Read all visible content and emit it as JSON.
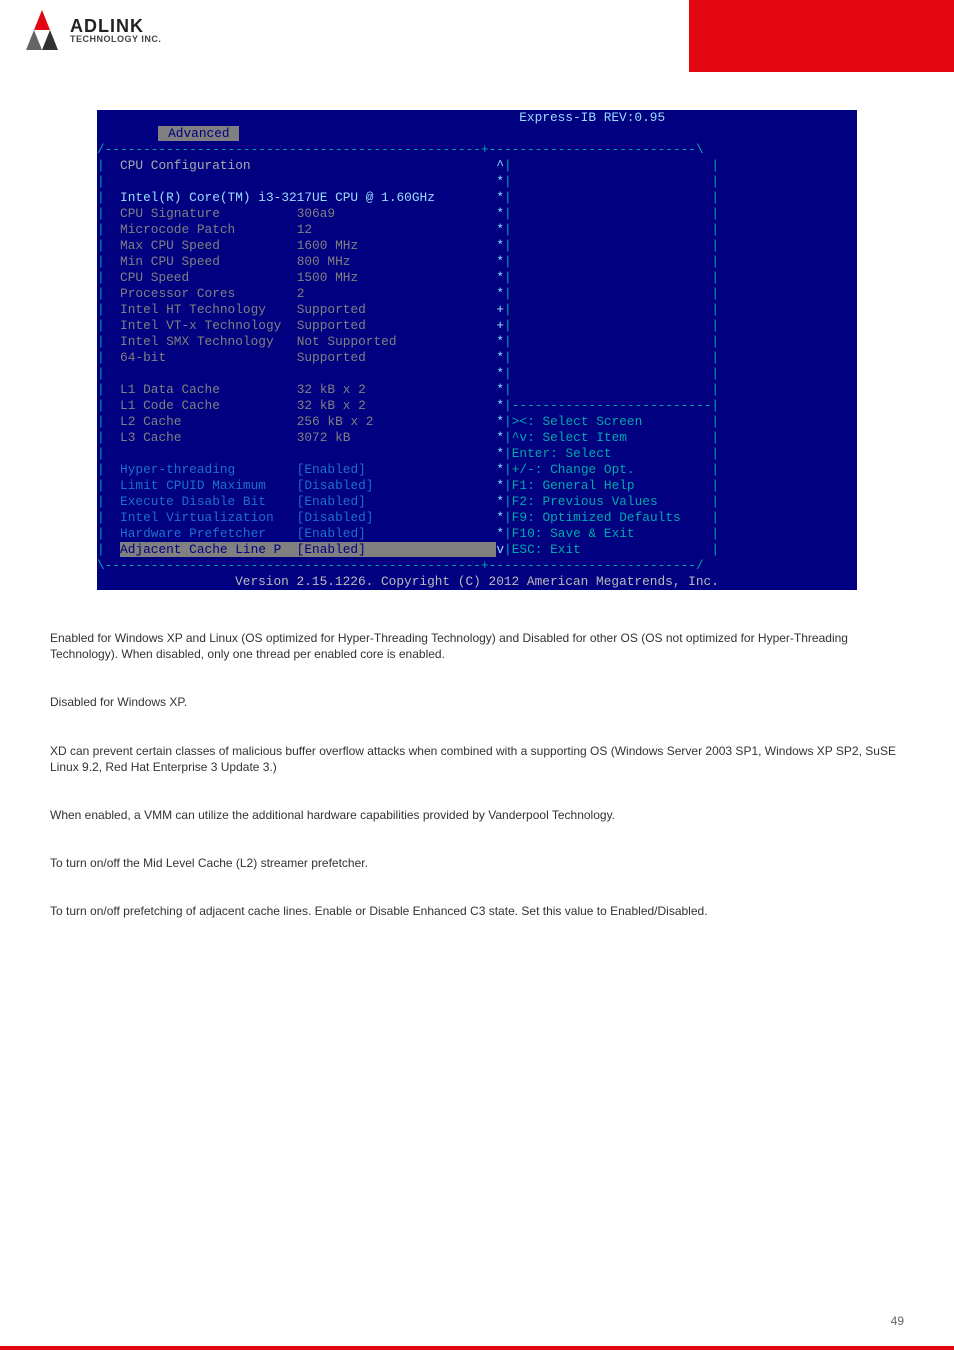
{
  "header": {
    "brand_top": "ADLINK",
    "brand_bottom": "TECHNOLOGY INC."
  },
  "bios": {
    "title": "Express-IB REV:0.95",
    "tab": "Advanced",
    "section_title": "CPU Configuration",
    "cpu_model": "Intel(R) Core(TM) i3-3217UE CPU @ 1.60GHz",
    "info_rows": [
      {
        "label": "CPU Signature",
        "value": "306a9",
        "mark": "*"
      },
      {
        "label": "Microcode Patch",
        "value": "12",
        "mark": "*"
      },
      {
        "label": "Max CPU Speed",
        "value": "1600 MHz",
        "mark": "*"
      },
      {
        "label": "Min CPU Speed",
        "value": "800 MHz",
        "mark": "*"
      },
      {
        "label": "CPU Speed",
        "value": "1500 MHz",
        "mark": "*"
      },
      {
        "label": "Processor Cores",
        "value": "2",
        "mark": "*"
      },
      {
        "label": "Intel HT Technology",
        "value": "Supported",
        "mark": "+"
      },
      {
        "label": "Intel VT-x Technology",
        "value": "Supported",
        "mark": "+"
      },
      {
        "label": "Intel SMX Technology",
        "value": "Not Supported",
        "mark": "*"
      },
      {
        "label": "64-bit",
        "value": "Supported",
        "mark": "*"
      }
    ],
    "cache_rows": [
      {
        "label": "L1 Data Cache",
        "value": "32 kB x 2",
        "mark": "*"
      },
      {
        "label": "L1 Code Cache",
        "value": "32 kB x 2",
        "mark": "*"
      },
      {
        "label": "L2 Cache",
        "value": "256 kB x 2",
        "mark": "*"
      },
      {
        "label": "L3 Cache",
        "value": "3072 kB",
        "mark": "*"
      }
    ],
    "option_rows": [
      {
        "label": "Hyper-threading",
        "value": "[Enabled]",
        "mark": "*"
      },
      {
        "label": "Limit CPUID Maximum",
        "value": "[Disabled]",
        "mark": "*"
      },
      {
        "label": "Execute Disable Bit",
        "value": "[Enabled]",
        "mark": "*"
      },
      {
        "label": "Intel Virtualization",
        "value": "[Disabled]",
        "mark": "*"
      },
      {
        "label": "Hardware Prefetcher",
        "value": "[Enabled]",
        "mark": "*"
      },
      {
        "label": "Adjacent Cache Line P",
        "value": "[Enabled]",
        "mark": "v",
        "selected": true
      }
    ],
    "help_lines": [
      "><: Select Screen",
      "^v: Select Item",
      "Enter: Select",
      "+/-: Change Opt.",
      "F1: General Help",
      "F2: Previous Values",
      "F9: Optimized Defaults",
      "F10: Save & Exit",
      "ESC: Exit"
    ],
    "footer": "Version 2.15.1226. Copyright (C) 2012 American Megatrends, Inc."
  },
  "paragraphs": [
    "Enabled for Windows XP and Linux (OS optimized for Hyper-Threading Technology) and Disabled for other OS (OS not optimized for Hyper-Threading Technology). When disabled, only one thread per enabled core is enabled.",
    "Disabled for Windows XP.",
    "XD can prevent certain classes of malicious buffer overflow attacks when combined with a supporting OS (Windows Server 2003 SP1, Windows XP SP2, SuSE Linux 9.2, Red Hat Enterprise 3 Update 3.)",
    "When enabled, a VMM can utilize the additional hardware capabilities provided by Vanderpool Technology.",
    "To turn on/off the Mid Level Cache (L2) streamer prefetcher.",
    "To turn on/off prefetching of adjacent cache lines. Enable or Disable Enhanced C3 state. Set this value to Enabled/Disabled."
  ],
  "page_number": "49"
}
